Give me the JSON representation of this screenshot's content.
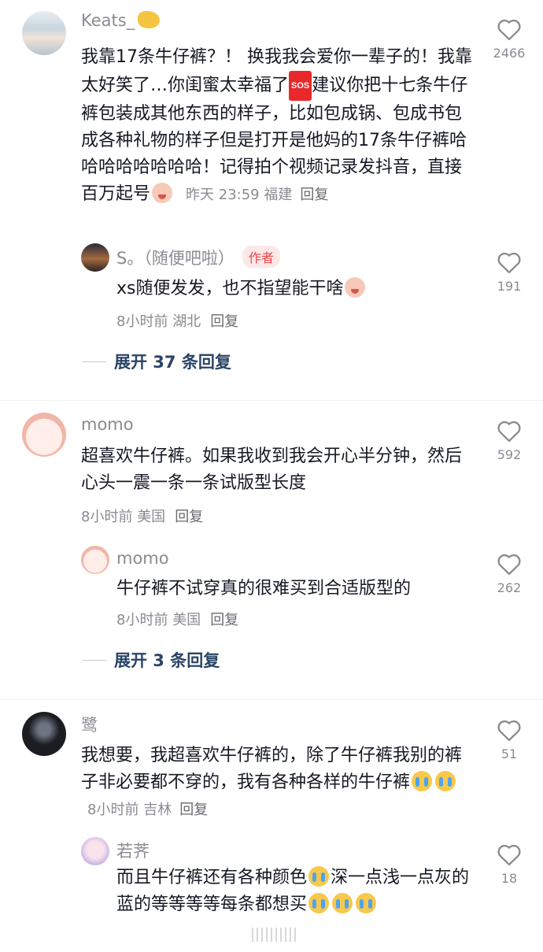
{
  "comments": [
    {
      "name": "Keats_",
      "text_parts": [
        "我靠17条牛仔裤？！ 换我我会爱你一辈子的！我靠太好笑了…你闺蜜太幸福了",
        "建议你把十七条牛仔裤包装成其他东西的样子，比如包成锅、包成书包成各种礼物的样子但是打开是他妈的17条牛仔裤哈哈哈哈哈哈哈哈！记得拍个视频记录发抖音，直接百万起号"
      ],
      "sos": "SOS",
      "time": "昨天 23:59",
      "location": "福建",
      "reply_label": "回复",
      "likes": "2466"
    },
    {
      "name": "S。（随便吧啦）",
      "badge": "作者",
      "text": "xs随便发发，也不指望能干啥",
      "time": "8小时前",
      "location": "湖北",
      "reply_label": "回复",
      "likes": "191"
    },
    {
      "name": "momo",
      "text": "超喜欢牛仔裤。如果我收到我会开心半分钟，然后心头一震一条一条试版型长度",
      "time": "8小时前",
      "location": "美国",
      "reply_label": "回复",
      "likes": "592"
    },
    {
      "name": "momo",
      "text": "牛仔裤不试穿真的很难买到合适版型的",
      "time": "8小时前",
      "location": "美国",
      "reply_label": "回复",
      "likes": "262"
    },
    {
      "name": "鹭",
      "text": "我想要，我超喜欢牛仔裤的，除了牛仔裤我别的裤子非必要都不穿的，我有各种各样的牛仔裤",
      "time": "8小时前",
      "location": "吉林",
      "reply_label": "回复",
      "likes": "51"
    },
    {
      "name": "若荠",
      "text_parts": [
        "而且牛仔裤还有各种颜色",
        "深一点浅一点灰的蓝的等等等等每条都想买"
      ],
      "likes": "18"
    }
  ],
  "expand": [
    "展开 37 条回复",
    "展开 3 条回复"
  ],
  "colors": {
    "text": "#161823",
    "meta": "#8a8b91",
    "expand": "#2a4466",
    "badge": "#e8454b"
  },
  "icons": [
    "heart-outline-icon",
    "cry-emoji-icon",
    "baby-cry-emoji-icon",
    "sos-emoji-icon"
  ]
}
